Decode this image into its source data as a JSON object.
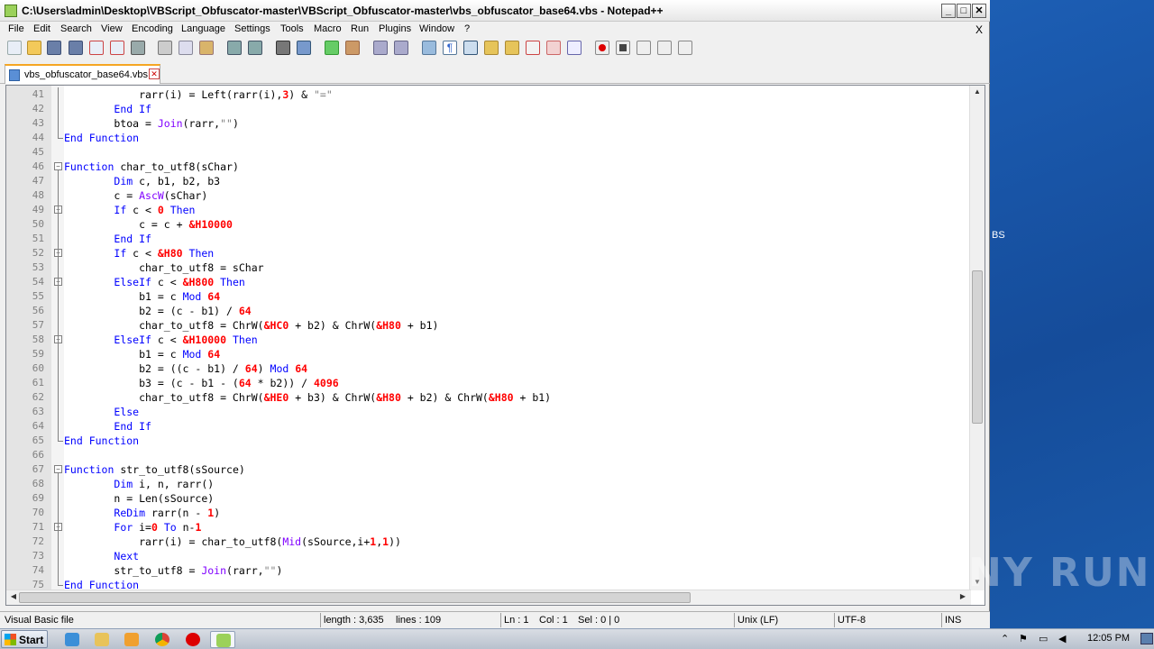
{
  "window": {
    "title": "C:\\Users\\admin\\Desktop\\VBScript_Obfuscator-master\\VBScript_Obfuscator-master\\vbs_obfuscator_base64.vbs - Notepad++"
  },
  "menu": [
    "File",
    "Edit",
    "Search",
    "View",
    "Encoding",
    "Language",
    "Settings",
    "Tools",
    "Macro",
    "Run",
    "Plugins",
    "Window",
    "?"
  ],
  "menu_close": "X",
  "tab": {
    "label": "vbs_obfuscator_base64.vbs"
  },
  "desktop_label": "BS",
  "code_lines": [
    {
      "n": "41",
      "t": [
        [
          "            rarr(i) = Left(rarr(i),",
          ""
        ],
        [
          "3",
          "num"
        ],
        [
          ") & ",
          ""
        ],
        [
          "\"=\"",
          "str"
        ]
      ]
    },
    {
      "n": "42",
      "t": [
        [
          "        ",
          ""
        ],
        [
          "End If",
          "kw"
        ]
      ]
    },
    {
      "n": "43",
      "t": [
        [
          "        btoa = ",
          ""
        ],
        [
          "Join",
          "fn"
        ],
        [
          "(rarr,",
          ""
        ],
        [
          "\"\"",
          "str"
        ],
        [
          ")",
          ""
        ]
      ]
    },
    {
      "n": "44",
      "t": [
        [
          "",
          ""
        ],
        [
          "End Function",
          "kw"
        ]
      ]
    },
    {
      "n": "45",
      "t": [
        [
          "",
          ""
        ]
      ]
    },
    {
      "n": "46",
      "t": [
        [
          "",
          ""
        ],
        [
          "Function",
          "kw"
        ],
        [
          " char_to_utf8(sChar)",
          ""
        ]
      ]
    },
    {
      "n": "47",
      "t": [
        [
          "        ",
          ""
        ],
        [
          "Dim",
          "kw"
        ],
        [
          " c, b1, b2, b3",
          ""
        ]
      ]
    },
    {
      "n": "48",
      "t": [
        [
          "        c = ",
          ""
        ],
        [
          "AscW",
          "fn"
        ],
        [
          "(sChar)",
          ""
        ]
      ]
    },
    {
      "n": "49",
      "t": [
        [
          "        ",
          ""
        ],
        [
          "If",
          "kw"
        ],
        [
          " c < ",
          ""
        ],
        [
          "0",
          "num"
        ],
        [
          " ",
          ""
        ],
        [
          "Then",
          "kw"
        ]
      ]
    },
    {
      "n": "50",
      "t": [
        [
          "            c = c + ",
          ""
        ],
        [
          "&H10000",
          "num"
        ]
      ]
    },
    {
      "n": "51",
      "t": [
        [
          "        ",
          ""
        ],
        [
          "End If",
          "kw"
        ]
      ]
    },
    {
      "n": "52",
      "t": [
        [
          "        ",
          ""
        ],
        [
          "If",
          "kw"
        ],
        [
          " c < ",
          ""
        ],
        [
          "&H80",
          "num"
        ],
        [
          " ",
          ""
        ],
        [
          "Then",
          "kw"
        ]
      ]
    },
    {
      "n": "53",
      "t": [
        [
          "            char_to_utf8 = sChar",
          ""
        ]
      ]
    },
    {
      "n": "54",
      "t": [
        [
          "        ",
          ""
        ],
        [
          "ElseIf",
          "kw"
        ],
        [
          " c < ",
          ""
        ],
        [
          "&H800",
          "num"
        ],
        [
          " ",
          ""
        ],
        [
          "Then",
          "kw"
        ]
      ]
    },
    {
      "n": "55",
      "t": [
        [
          "            b1 = c ",
          ""
        ],
        [
          "Mod",
          "kw"
        ],
        [
          " ",
          ""
        ],
        [
          "64",
          "num"
        ]
      ]
    },
    {
      "n": "56",
      "t": [
        [
          "            b2 = (c - b1) / ",
          ""
        ],
        [
          "64",
          "num"
        ]
      ]
    },
    {
      "n": "57",
      "t": [
        [
          "            char_to_utf8 = ChrW(",
          ""
        ],
        [
          "&HC0",
          "num"
        ],
        [
          " + b2) & ChrW(",
          ""
        ],
        [
          "&H80",
          "num"
        ],
        [
          " + b1)",
          ""
        ]
      ]
    },
    {
      "n": "58",
      "t": [
        [
          "        ",
          ""
        ],
        [
          "ElseIf",
          "kw"
        ],
        [
          " c < ",
          ""
        ],
        [
          "&H10000",
          "num"
        ],
        [
          " ",
          ""
        ],
        [
          "Then",
          "kw"
        ]
      ]
    },
    {
      "n": "59",
      "t": [
        [
          "            b1 = c ",
          ""
        ],
        [
          "Mod",
          "kw"
        ],
        [
          " ",
          ""
        ],
        [
          "64",
          "num"
        ]
      ]
    },
    {
      "n": "60",
      "t": [
        [
          "            b2 = ((c - b1) / ",
          ""
        ],
        [
          "64",
          "num"
        ],
        [
          ") ",
          ""
        ],
        [
          "Mod",
          "kw"
        ],
        [
          " ",
          ""
        ],
        [
          "64",
          "num"
        ]
      ]
    },
    {
      "n": "61",
      "t": [
        [
          "            b3 = (c - b1 - (",
          ""
        ],
        [
          "64",
          "num"
        ],
        [
          " * b2)) / ",
          ""
        ],
        [
          "4096",
          "num"
        ]
      ]
    },
    {
      "n": "62",
      "t": [
        [
          "            char_to_utf8 = ChrW(",
          ""
        ],
        [
          "&HE0",
          "num"
        ],
        [
          " + b3) & ChrW(",
          ""
        ],
        [
          "&H80",
          "num"
        ],
        [
          " + b2) & ChrW(",
          ""
        ],
        [
          "&H80",
          "num"
        ],
        [
          " + b1)",
          ""
        ]
      ]
    },
    {
      "n": "63",
      "t": [
        [
          "        ",
          ""
        ],
        [
          "Else",
          "kw"
        ]
      ]
    },
    {
      "n": "64",
      "t": [
        [
          "        ",
          ""
        ],
        [
          "End If",
          "kw"
        ]
      ]
    },
    {
      "n": "65",
      "t": [
        [
          "",
          ""
        ],
        [
          "End Function",
          "kw"
        ]
      ]
    },
    {
      "n": "66",
      "t": [
        [
          "",
          ""
        ]
      ]
    },
    {
      "n": "67",
      "t": [
        [
          "",
          ""
        ],
        [
          "Function",
          "kw"
        ],
        [
          " str_to_utf8(sSource)",
          ""
        ]
      ]
    },
    {
      "n": "68",
      "t": [
        [
          "        ",
          ""
        ],
        [
          "Dim",
          "kw"
        ],
        [
          " i, n, rarr()",
          ""
        ]
      ]
    },
    {
      "n": "69",
      "t": [
        [
          "        n = Len(sSource)",
          ""
        ]
      ]
    },
    {
      "n": "70",
      "t": [
        [
          "        ",
          ""
        ],
        [
          "ReDim",
          "kw"
        ],
        [
          " rarr(n - ",
          ""
        ],
        [
          "1",
          "num"
        ],
        [
          ")",
          ""
        ]
      ]
    },
    {
      "n": "71",
      "t": [
        [
          "        ",
          ""
        ],
        [
          "For",
          "kw"
        ],
        [
          " i=",
          ""
        ],
        [
          "0",
          "num"
        ],
        [
          " ",
          ""
        ],
        [
          "To",
          "kw"
        ],
        [
          " n-",
          ""
        ],
        [
          "1",
          "num"
        ]
      ]
    },
    {
      "n": "72",
      "t": [
        [
          "            rarr(i) = char_to_utf8(",
          ""
        ],
        [
          "Mid",
          "fn"
        ],
        [
          "(sSource,i+",
          ""
        ],
        [
          "1",
          "num"
        ],
        [
          ",",
          ""
        ],
        [
          "1",
          "num"
        ],
        [
          "))",
          ""
        ]
      ]
    },
    {
      "n": "73",
      "t": [
        [
          "        ",
          ""
        ],
        [
          "Next",
          "kw"
        ]
      ]
    },
    {
      "n": "74",
      "t": [
        [
          "        str_to_utf8 = ",
          ""
        ],
        [
          "Join",
          "fn"
        ],
        [
          "(rarr,",
          ""
        ],
        [
          "\"\"",
          "str"
        ],
        [
          ")",
          ""
        ]
      ]
    },
    {
      "n": "75",
      "t": [
        [
          "",
          ""
        ],
        [
          "End Function",
          "kw"
        ]
      ]
    }
  ],
  "status": {
    "file_type": "Visual Basic file",
    "length": "length : 3,635",
    "lines": "lines : 109",
    "ln": "Ln : 1",
    "col": "Col : 1",
    "sel": "Sel : 0 | 0",
    "eol": "Unix (LF)",
    "encoding": "UTF-8",
    "mode": "INS"
  },
  "taskbar": {
    "start_label": "Start",
    "clock": "12:05 PM"
  },
  "watermark": "ANY RUN"
}
